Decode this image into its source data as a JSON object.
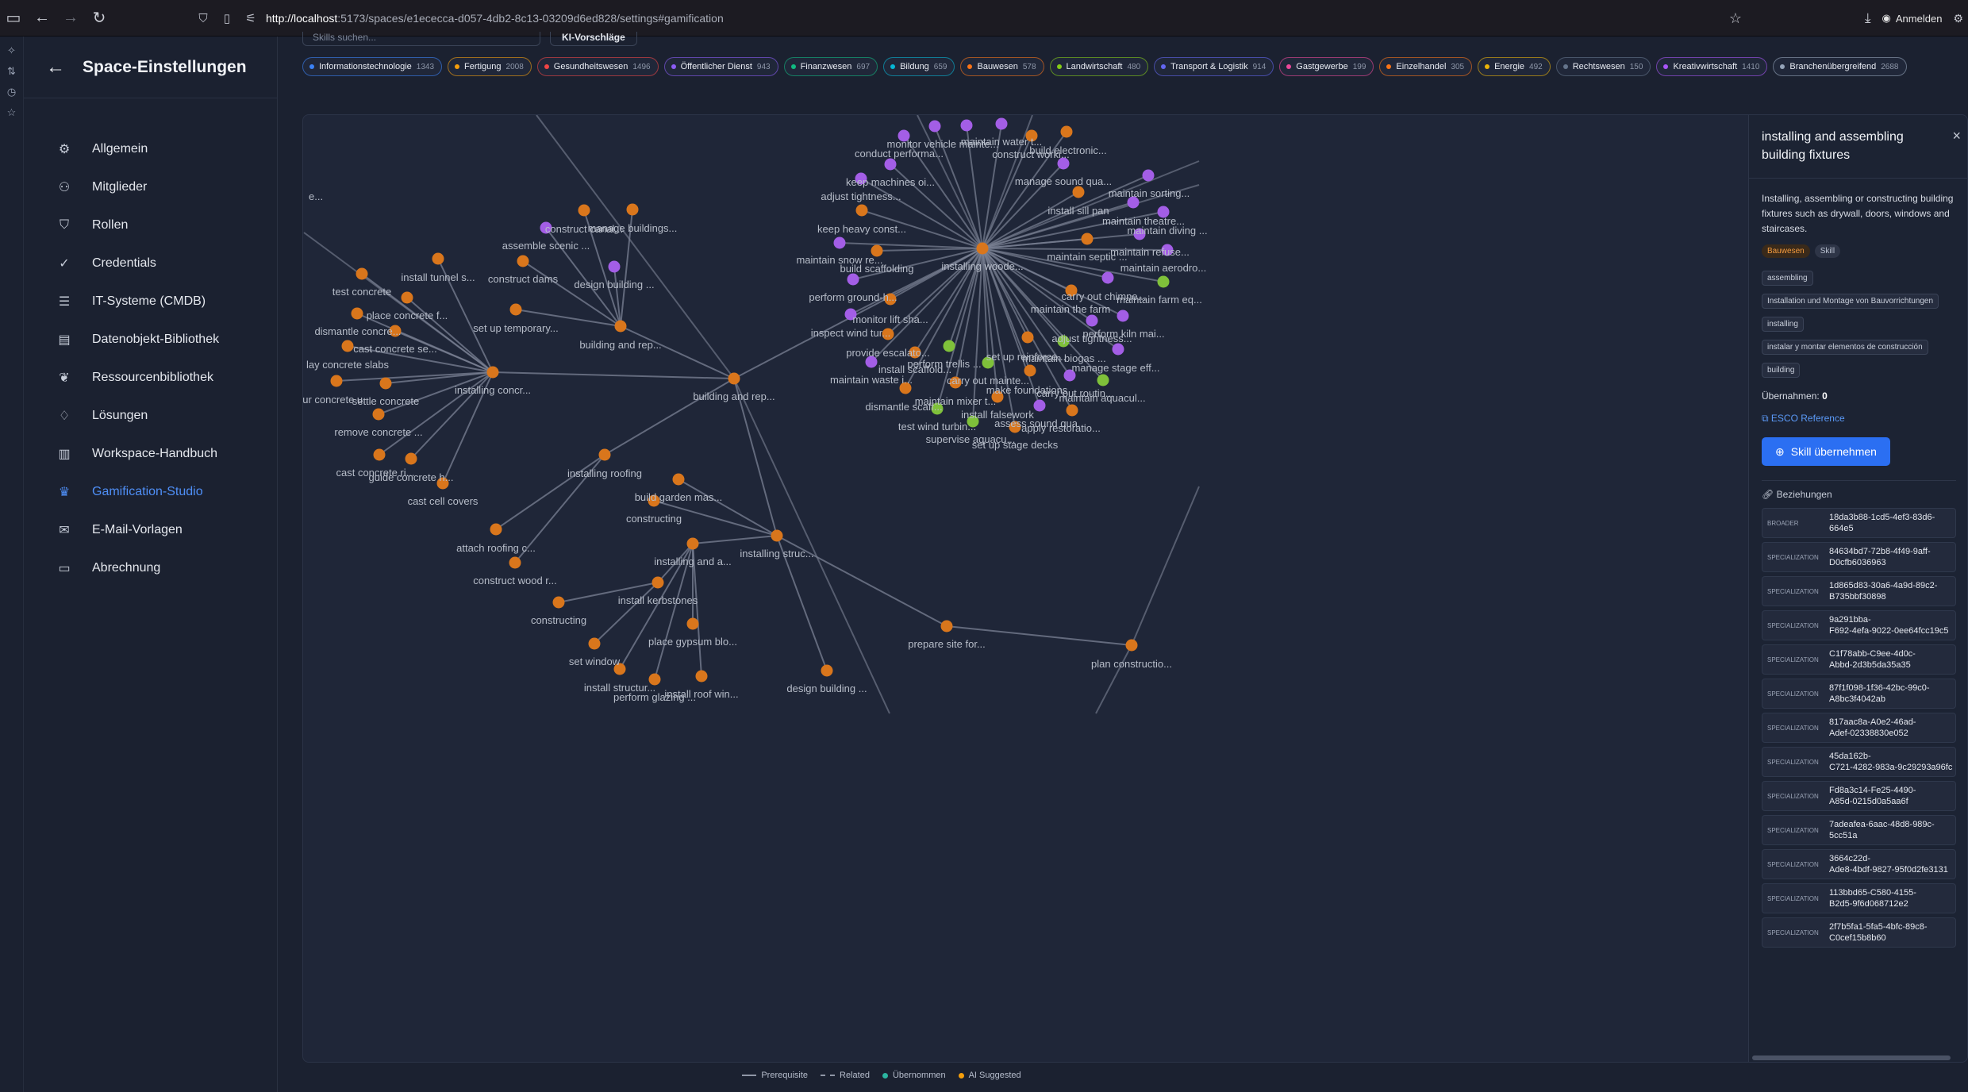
{
  "browser": {
    "url_host": "http://localhost",
    "url_rest": ":5173/spaces/e1ececca-d057-4db2-8c13-03209d6ed828/settings#gamification",
    "signin": "Anmelden"
  },
  "sidebar": {
    "title": "Space-Einstellungen",
    "items": [
      {
        "label": "Allgemein",
        "icon": "gear-icon"
      },
      {
        "label": "Mitglieder",
        "icon": "users-icon"
      },
      {
        "label": "Rollen",
        "icon": "shield-icon"
      },
      {
        "label": "Credentials",
        "icon": "check-circle-icon"
      },
      {
        "label": "IT-Systeme (CMDB)",
        "icon": "server-icon"
      },
      {
        "label": "Datenobjekt-Bibliothek",
        "icon": "document-icon"
      },
      {
        "label": "Ressourcenbibliothek",
        "icon": "leaf-icon"
      },
      {
        "label": "Lösungen",
        "icon": "lightbulb-icon"
      },
      {
        "label": "Workspace-Handbuch",
        "icon": "book-icon"
      },
      {
        "label": "Gamification-Studio",
        "icon": "trophy-icon",
        "active": true
      },
      {
        "label": "E-Mail-Vorlagen",
        "icon": "mail-icon"
      },
      {
        "label": "Abrechnung",
        "icon": "card-icon"
      }
    ]
  },
  "toolbar": {
    "search_placeholder": "Skills suchen...",
    "ki_label": "KI-Vorschläge"
  },
  "chips": [
    {
      "label": "Informationstechnologie",
      "count": "1343",
      "color": "#3b82f6"
    },
    {
      "label": "Fertigung",
      "count": "2008",
      "color": "#f59e0b"
    },
    {
      "label": "Gesundheitswesen",
      "count": "1496",
      "color": "#ef4444"
    },
    {
      "label": "Öffentlicher Dienst",
      "count": "943",
      "color": "#8b5cf6"
    },
    {
      "label": "Finanzwesen",
      "count": "697",
      "color": "#10b981"
    },
    {
      "label": "Bildung",
      "count": "659",
      "color": "#06b6d4"
    },
    {
      "label": "Bauwesen",
      "count": "578",
      "color": "#f97316"
    },
    {
      "label": "Landwirtschaft",
      "count": "480",
      "color": "#84cc16"
    },
    {
      "label": "Transport & Logistik",
      "count": "914",
      "color": "#6366f1"
    },
    {
      "label": "Gastgewerbe",
      "count": "199",
      "color": "#ec4899"
    },
    {
      "label": "Einzelhandel",
      "count": "305",
      "color": "#f97316"
    },
    {
      "label": "Energie",
      "count": "492",
      "color": "#eab308"
    },
    {
      "label": "Rechtswesen",
      "count": "150",
      "color": "#64748b"
    },
    {
      "label": "Kreativwirtschaft",
      "count": "1410",
      "color": "#a855f7"
    },
    {
      "label": "Branchenübergreifend",
      "count": "2688",
      "color": "#94a3b8"
    }
  ],
  "graph": {
    "colors": {
      "orange": "#d9761c",
      "purple": "#a35ee6",
      "green": "#7fc13a",
      "edge": "#7b8294",
      "label": "#b7bdc9"
    },
    "labels": [
      "e...",
      "test concrete",
      "install tunnel s...",
      "place concrete f...",
      "dismantle concre...",
      "cast concrete se...",
      "lay concrete slabs",
      "our concrete u...",
      "settle concrete",
      "remove concrete ...",
      "cast concrete ri...",
      "guide concrete h...",
      "cast cell covers",
      "installing concr...",
      "construct canal...",
      "manage buildings...",
      "assemble scenic ...",
      "construct dams",
      "design building ...",
      "set up temporary...",
      "building and rep...",
      "building and rep...",
      "installing roofing",
      "build garden mas...",
      "constructing",
      "attach roofing c...",
      "construct wood r...",
      "constructing",
      "installing and a...",
      "installing struc...",
      "install kerbstones",
      "place gypsum blo...",
      "set window",
      "install structur...",
      "perform glazing ...",
      "install roof win...",
      "design building ...",
      "prepare site for...",
      "plan constructio...",
      "monitor vehicle mainte...",
      "maintain water t...",
      "build electronic...",
      "construct worki...",
      "conduct performa...",
      "keep machines oi...",
      "manage sound qua...",
      "adjust tightness...",
      "maintain sorting...",
      "install sill pan",
      "maintain theatre...",
      "keep heavy const...",
      "maintain diving ...",
      "maintain snow re...",
      "installing woode...",
      "maintain septic ...",
      "maintain refuse...",
      "build scaffolding",
      "maintain aerodro...",
      "perform ground-h...",
      "carry out chimne...",
      "maintain farm eq...",
      "monitor lift sha...",
      "maintain the farm",
      "inspect wind tur...",
      "adjust tightness...",
      "perform kiln mai...",
      "provide escalato...",
      "maintain biogas ...",
      "perform trellis ...",
      "set up reinforce...",
      "install scaffold...",
      "manage stage eff...",
      "maintain waste i...",
      "carry out mainte...",
      "make foundations",
      "carry out routin...",
      "dismantle scaff...",
      "maintain mixer t...",
      "maintain aquacul...",
      "install falsework",
      "assess sound qua...",
      "test wind turbin...",
      "apply restoratio...",
      "supervise aquacu...",
      "set up stage decks"
    ]
  },
  "legend": [
    {
      "label": "Prerequisite",
      "kind": "line"
    },
    {
      "label": "Related",
      "kind": "dash"
    },
    {
      "label": "Übernommen",
      "kind": "dot",
      "color": "#2bb5a0"
    },
    {
      "label": "AI Suggested",
      "kind": "dot",
      "color": "#f59e0b"
    }
  ],
  "detail": {
    "title": "installing and assembling building fixtures",
    "description": "Installing, assembling or constructing building fixtures such as drywall, doors, windows and staircases.",
    "tags": [
      "Bauwesen",
      "Skill"
    ],
    "alt_labels": [
      "assembling",
      "Installation und Montage von Bauvorrichtungen",
      "installing",
      "instalar y montar elementos de construcción",
      "building"
    ],
    "uebernahmen_label": "Übernahmen:",
    "uebernahmen_value": "0",
    "esco_link": "ESCO Reference",
    "adopt_button": "Skill übernehmen",
    "relations_heading": "Beziehungen",
    "relations": [
      {
        "type": "BROADER",
        "id": "18da3b88-1cd5-4ef3-83d6-664e5"
      },
      {
        "type": "SPECIALIZATION",
        "id": "84634bd7-72b8-4f49-9aff-\nD0cfb6036963"
      },
      {
        "type": "SPECIALIZATION",
        "id": "1d865d83-30a6-4a9d-89c2-\nB735bbf30898"
      },
      {
        "type": "SPECIALIZATION",
        "id": "9a291bba-\nF692-4efa-9022-0ee64fcc19c5"
      },
      {
        "type": "SPECIALIZATION",
        "id": "C1f78abb-C9ee-4d0c-\nAbbd-2d3b5da35a35"
      },
      {
        "type": "SPECIALIZATION",
        "id": "87f1f098-1f36-42bc-99c0-\nA8bc3f4042ab"
      },
      {
        "type": "SPECIALIZATION",
        "id": "817aac8a-A0e2-46ad-\nAdef-02338830e052"
      },
      {
        "type": "SPECIALIZATION",
        "id": "45da162b-\nC721-4282-983a-9c29293a96fc"
      },
      {
        "type": "SPECIALIZATION",
        "id": "Fd8a3c14-Fe25-4490-\nA85d-0215d0a5aa6f"
      },
      {
        "type": "SPECIALIZATION",
        "id": "7adeafea-6aac-48d8-989c-5cc51a"
      },
      {
        "type": "SPECIALIZATION",
        "id": "3664c22d-\nAde8-4bdf-9827-95f0d2fe3131"
      },
      {
        "type": "SPECIALIZATION",
        "id": "113bbd65-C580-4155-\nB2d5-9f6d068712e2"
      },
      {
        "type": "SPECIALIZATION",
        "id": "2f7b5fa1-5fa5-4bfc-89c8-\nC0cef15b8b60"
      }
    ]
  }
}
